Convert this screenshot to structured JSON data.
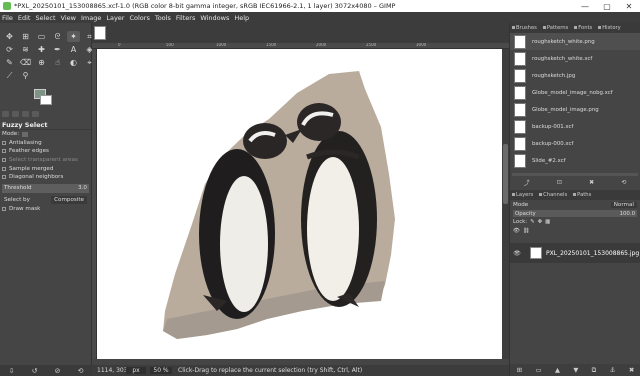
{
  "window": {
    "title": "*PXL_20250101_153008865.xcf-1.0 (RGB color 8-bit gamma integer, sRGB IEC61966-2.1, 1 layer) 3072x4080 – GIMP",
    "minimize": "—",
    "maximize": "▢",
    "close": "✕"
  },
  "menu": [
    "File",
    "Edit",
    "Select",
    "View",
    "Image",
    "Layer",
    "Colors",
    "Tools",
    "Filters",
    "Windows",
    "Help"
  ],
  "tool_options": {
    "title": "Fuzzy Select",
    "mode_label": "Mode:",
    "antialiasing": "Antialiasing",
    "feather": "Feather edges",
    "transparent": "Select transparent areas",
    "sample_merged": "Sample merged",
    "diagonal": "Diagonal neighbors",
    "threshold_label": "Threshold",
    "threshold_value": "3.0",
    "select_by_label": "Select by",
    "select_by_value": "Composite",
    "draw_mask": "Draw mask"
  },
  "ruler_marks": [
    "0",
    "500",
    "1000",
    "1500",
    "2000",
    "2500",
    "3000"
  ],
  "status": {
    "coords": "1114, 3030",
    "unit": "px",
    "zoom": "50 %",
    "message": "Click-Drag to replace the current selection (try Shift, Ctrl, Alt)"
  },
  "dock_top": {
    "tabs": [
      "Brushes",
      "Patterns",
      "Fonts",
      "History"
    ],
    "items": [
      "roughsketch_white.png",
      "roughsketch_white.xcf",
      "roughsketch.jpg",
      "Globe_model_image_nobg.xcf",
      "Globe_model_image.png",
      "backup-001.xcf",
      "backup-000.xcf",
      "Slide_#2.xcf"
    ]
  },
  "dock_bottom": {
    "tabs": [
      "Layers",
      "Channels",
      "Paths"
    ],
    "mode_label": "Mode",
    "mode_value": "Normal",
    "opacity_label": "Opacity",
    "opacity_value": "100.0",
    "lock_label": "Lock:",
    "layer_name": "PXL_20250101_153008865.jpg"
  },
  "colors": {
    "accent": "#7c9385",
    "bg": "#454545"
  }
}
